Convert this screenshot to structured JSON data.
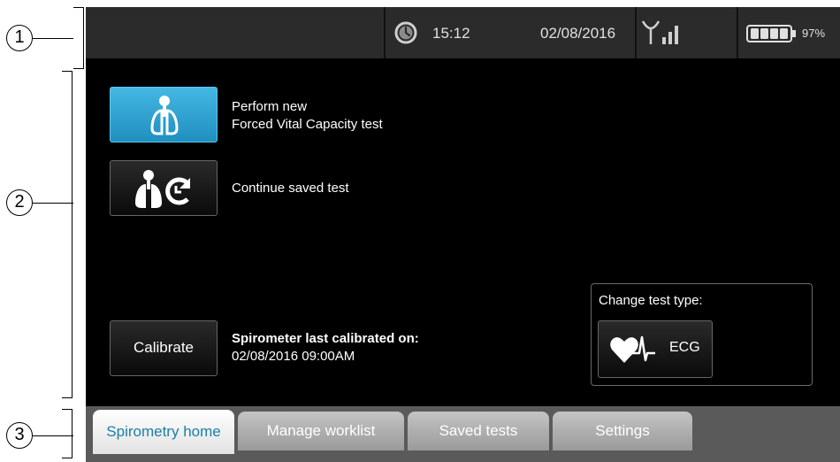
{
  "callouts": [
    "1",
    "2",
    "3"
  ],
  "status_bar": {
    "time": "15:12",
    "date": "02/08/2016",
    "battery_percent": "97%",
    "battery_level": 0.97
  },
  "main": {
    "perform_label_line1": "Perform new",
    "perform_label_line2": "Forced Vital Capacity test",
    "continue_label": "Continue saved test",
    "calibrate_button": "Calibrate",
    "calibration_title": "Spirometer last calibrated on:",
    "calibration_value": "02/08/2016 09:00AM",
    "change_test_type_label": "Change test type:",
    "ecg_button": "ECG"
  },
  "tabs": [
    {
      "label": "Spirometry home",
      "active": true
    },
    {
      "label": "Manage worklist",
      "active": false
    },
    {
      "label": "Saved tests",
      "active": false
    },
    {
      "label": "Settings",
      "active": false
    }
  ],
  "colors": {
    "accent": "#2aa3d4",
    "status_bar_bg": "#2b2b2b",
    "screen_bg": "#000000",
    "active_tab_text": "#1a7fa8"
  },
  "icons": [
    "clock-icon",
    "signal-icon",
    "battery-icon",
    "lungs-icon",
    "lungs-resume-icon",
    "heart-ecg-icon"
  ]
}
